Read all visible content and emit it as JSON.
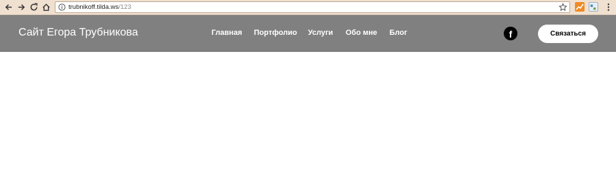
{
  "browser": {
    "url_host": "trubnikoff.tilda.ws",
    "url_path": "/123",
    "icons": [
      "back-icon",
      "forward-icon",
      "reload-icon",
      "home-icon",
      "info-icon",
      "star-icon",
      "extension-icon",
      "extension-icon",
      "menu-icon"
    ]
  },
  "header": {
    "title": "Сайт Егора Трубникова",
    "background": "#808080",
    "nav": [
      {
        "label": "Главная"
      },
      {
        "label": "Портфолио"
      },
      {
        "label": "Услуги"
      },
      {
        "label": "Обо мне"
      },
      {
        "label": "Блог"
      }
    ],
    "social_icon": "facebook-icon",
    "social_letter": "f",
    "contact_label": "Связаться"
  }
}
